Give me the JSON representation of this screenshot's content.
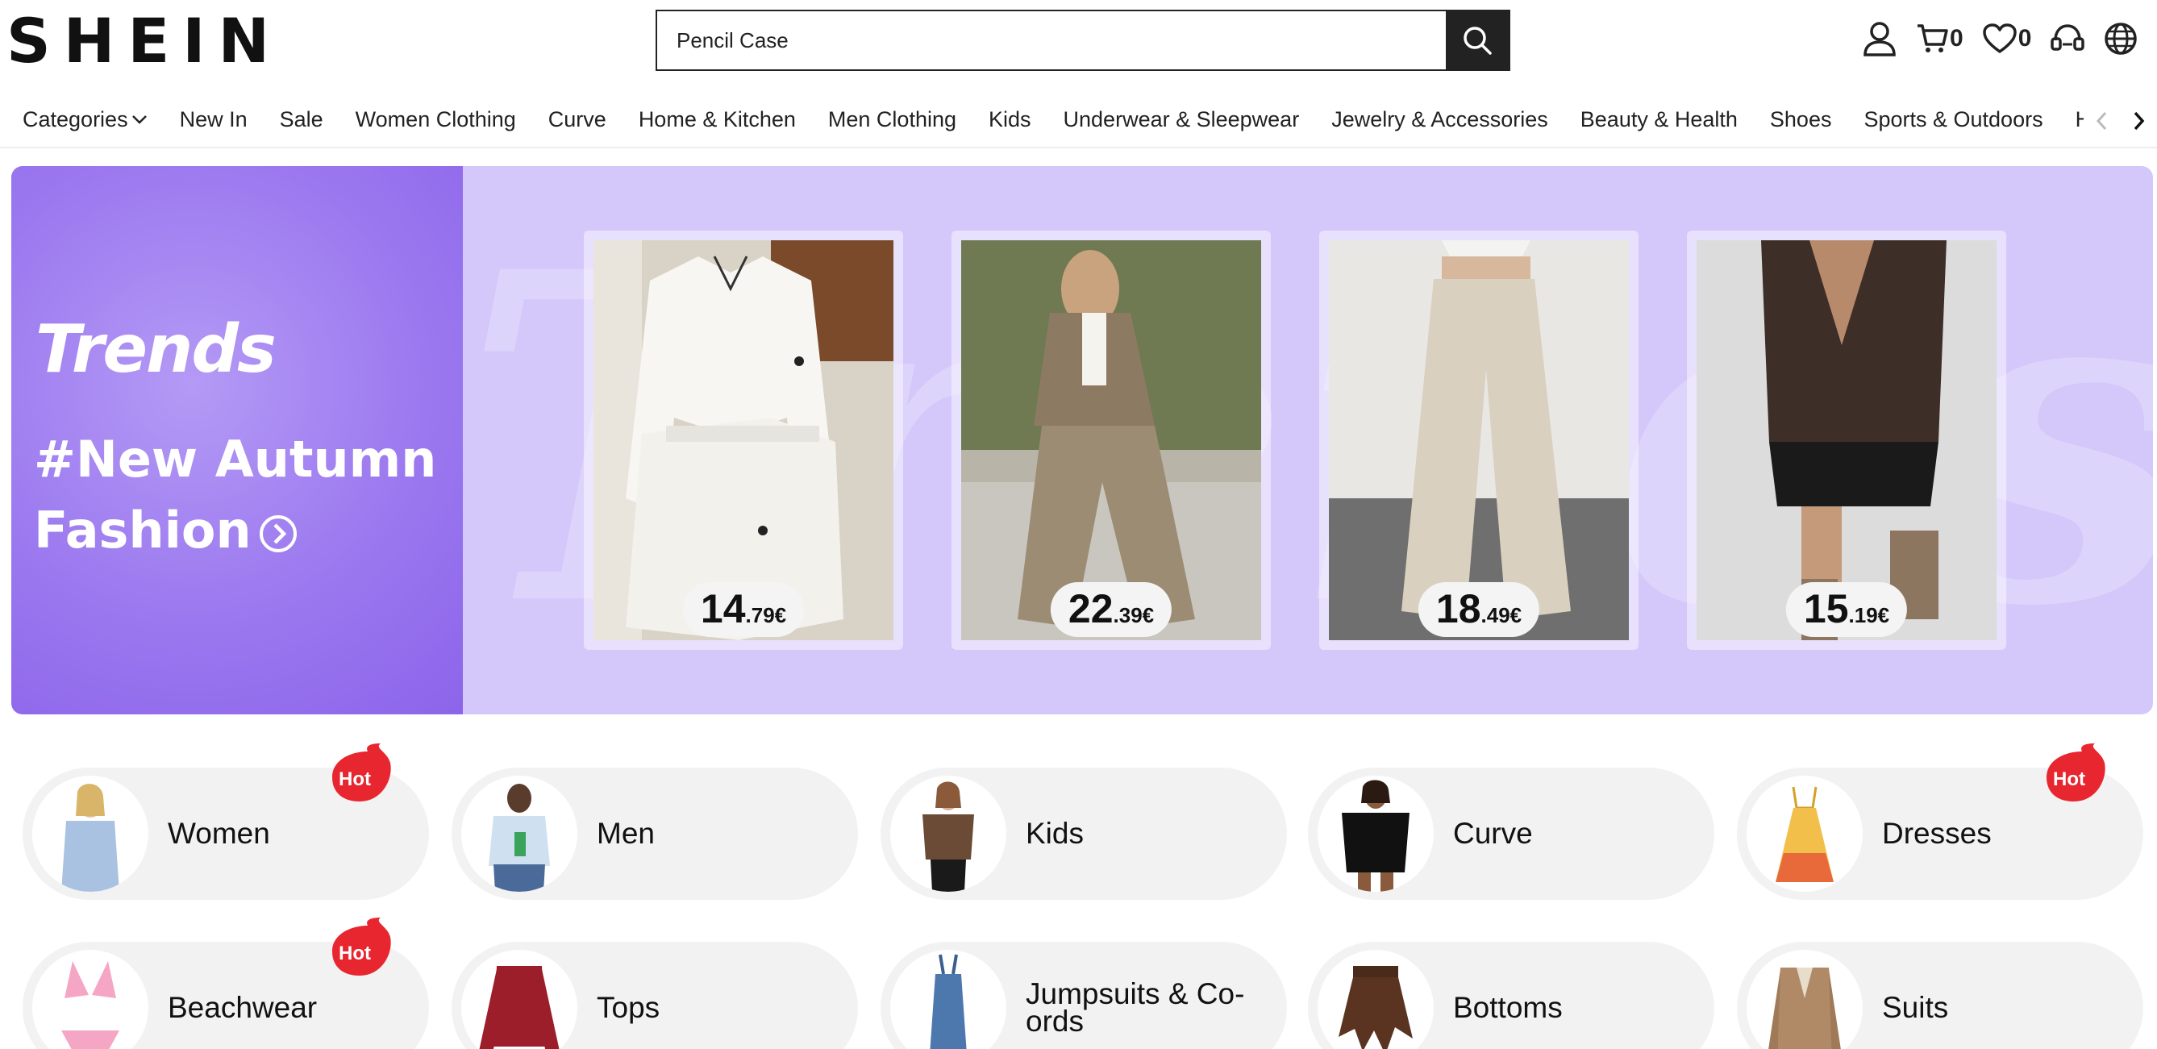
{
  "header": {
    "logo": "SHEIN",
    "search": {
      "value": "Pencil Case"
    },
    "cart_count": "0",
    "wishlist_count": "0"
  },
  "nav": {
    "items": [
      "Categories",
      "New In",
      "Sale",
      "Women Clothing",
      "Curve",
      "Home & Kitchen",
      "Men Clothing",
      "Kids",
      "Underwear & Sleepwear",
      "Jewelry & Accessories",
      "Beauty & Health",
      "Shoes",
      "Sports & Outdoors",
      "H"
    ]
  },
  "banner": {
    "logo_text": "Trends",
    "watermark": "Trends",
    "title": "#New Autumn Fashion",
    "products": [
      {
        "price_main": "14",
        "price_cents": ".79€"
      },
      {
        "price_main": "22",
        "price_cents": ".39€"
      },
      {
        "price_main": "18",
        "price_cents": ".49€"
      },
      {
        "price_main": "15",
        "price_cents": ".19€"
      }
    ]
  },
  "categories": [
    {
      "label": "Women",
      "hot": true
    },
    {
      "label": "Men",
      "hot": false
    },
    {
      "label": "Kids",
      "hot": false
    },
    {
      "label": "Curve",
      "hot": false
    },
    {
      "label": "Dresses",
      "hot": true
    },
    {
      "label": "Beachwear",
      "hot": true
    },
    {
      "label": "Tops",
      "hot": false
    },
    {
      "label": "Jumpsuits & Co-ords",
      "hot": false
    },
    {
      "label": "Bottoms",
      "hot": false
    },
    {
      "label": "Suits",
      "hot": false
    }
  ],
  "hot_badge": "Hot",
  "colors": {
    "accent": "#e8262f",
    "banner_purple": "#9b78ef",
    "banner_bg": "#d4c8fb"
  }
}
